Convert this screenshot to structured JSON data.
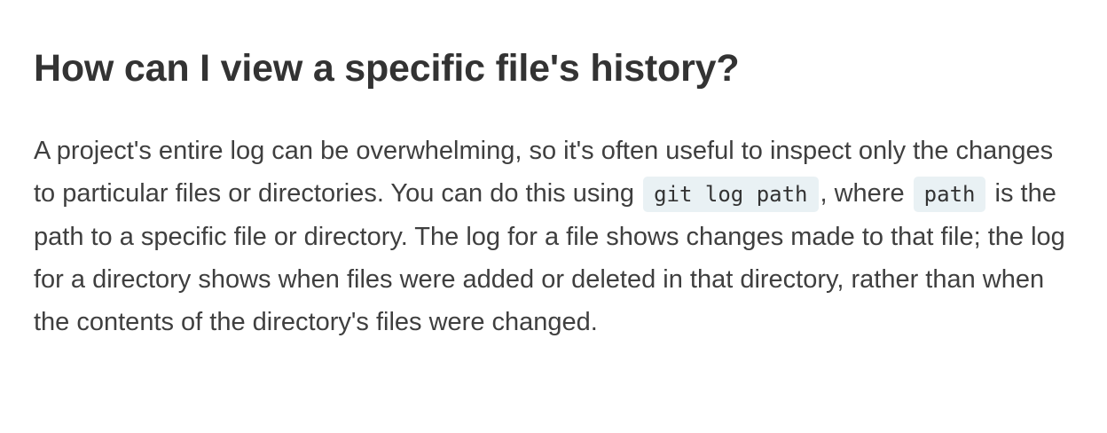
{
  "heading": "How can I view a specific file's history?",
  "paragraph": {
    "text_1": "A project's entire log can be overwhelming, so it's often useful to inspect only the changes to particular files or directories. You can do this using",
    "code_1": "git log path",
    "text_2": ", where",
    "code_2": "path",
    "text_3": "is the path to a specific file or directory. The log for a file shows changes made to that file; the log for a directory shows when files were added or deleted in that directory, rather than when the contents of the directory's files were changed."
  }
}
